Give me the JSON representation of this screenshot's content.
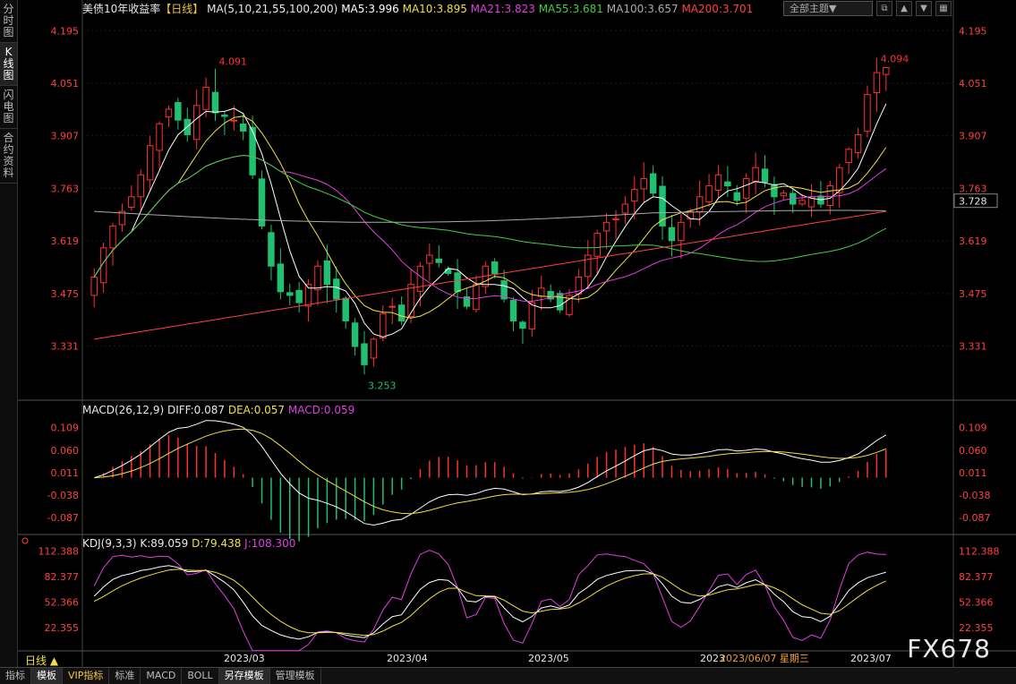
{
  "sidebar": [
    {
      "label": "分时图"
    },
    {
      "label": "K线图"
    },
    {
      "label": "闪电图"
    },
    {
      "label": "合约资料"
    }
  ],
  "header": {
    "title": "美债10年收益率",
    "period_tag": "【日线】",
    "ma_legend": "MA(5,10,21,55,100,200)",
    "ma_values": [
      {
        "text": "MA5:3.996",
        "color": "#ffffff"
      },
      {
        "text": "MA10:3.895",
        "color": "#f0e040"
      },
      {
        "text": "MA21:3.823",
        "color": "#e040e0"
      },
      {
        "text": "MA55:3.681",
        "color": "#40d040"
      },
      {
        "text": "MA100:3.657",
        "color": "#aaaaaa"
      },
      {
        "text": "MA200:3.701",
        "color": "#ff4040"
      }
    ],
    "theme_button": "全部主题▼",
    "win_icons": [
      "restore-icon",
      "up-icon",
      "down-icon",
      "grid-icon"
    ]
  },
  "price_axis": {
    "ticks": [
      "4.195",
      "4.051",
      "3.907",
      "3.763",
      "3.619",
      "3.475",
      "3.331"
    ],
    "current": "3.728",
    "high_label": "4.091",
    "high2_label": "4.094",
    "low_label": "3.253"
  },
  "macd": {
    "label": "MACD(26,12,9)",
    "diff": "DIFF:0.087",
    "dea": "DEA:0.057",
    "macd": "MACD:0.059",
    "ticks": [
      "0.109",
      "0.060",
      "0.011",
      "-0.038",
      "-0.087"
    ]
  },
  "kdj": {
    "label": "KDJ(9,3,3)",
    "k": "K:89.059",
    "d": "D:79.438",
    "j": "J:108.300",
    "ticks": [
      "112.388",
      "82.377",
      "52.366",
      "22.355"
    ]
  },
  "x_axis": {
    "labels": [
      "2023/03",
      "2023/04",
      "2023/05",
      "2023",
      "2023/07"
    ],
    "cursor_date": "2023/06/07",
    "cursor_weekday": "星期三"
  },
  "period_label": "日线 ▲",
  "bottom_tabs": [
    {
      "label": "指标"
    },
    {
      "label": "模板",
      "active": true
    },
    {
      "label": "VIP指标",
      "vip": true
    },
    {
      "label": "标准"
    },
    {
      "label": "MACD"
    },
    {
      "label": "BOLL"
    },
    {
      "label": "另存模板",
      "active": true
    },
    {
      "label": "管理模板"
    }
  ],
  "watermark": "FX678",
  "chart_data": {
    "type": "candlestick",
    "title": "美债10年收益率",
    "ylim": [
      3.2,
      4.23
    ],
    "close_path": [
      3.52,
      3.6,
      3.66,
      3.7,
      3.74,
      3.8,
      3.88,
      3.94,
      3.98,
      3.95,
      3.91,
      3.99,
      4.04,
      3.97,
      3.96,
      3.95,
      3.92,
      3.8,
      3.66,
      3.55,
      3.48,
      3.47,
      3.45,
      3.5,
      3.55,
      3.5,
      3.46,
      3.4,
      3.33,
      3.28,
      3.35,
      3.42,
      3.44,
      3.4,
      3.5,
      3.55,
      3.58,
      3.56,
      3.53,
      3.48,
      3.44,
      3.5,
      3.55,
      3.53,
      3.46,
      3.4,
      3.38,
      3.45,
      3.49,
      3.46,
      3.43,
      3.47,
      3.52,
      3.58,
      3.64,
      3.67,
      3.68,
      3.72,
      3.76,
      3.79,
      3.75,
      3.66,
      3.62,
      3.67,
      3.7,
      3.74,
      3.77,
      3.8,
      3.77,
      3.73,
      3.79,
      3.82,
      3.78,
      3.74,
      3.75,
      3.72,
      3.73,
      3.74,
      3.72,
      3.77,
      3.82,
      3.87,
      3.91,
      4.02,
      4.08,
      4.094
    ]
  }
}
